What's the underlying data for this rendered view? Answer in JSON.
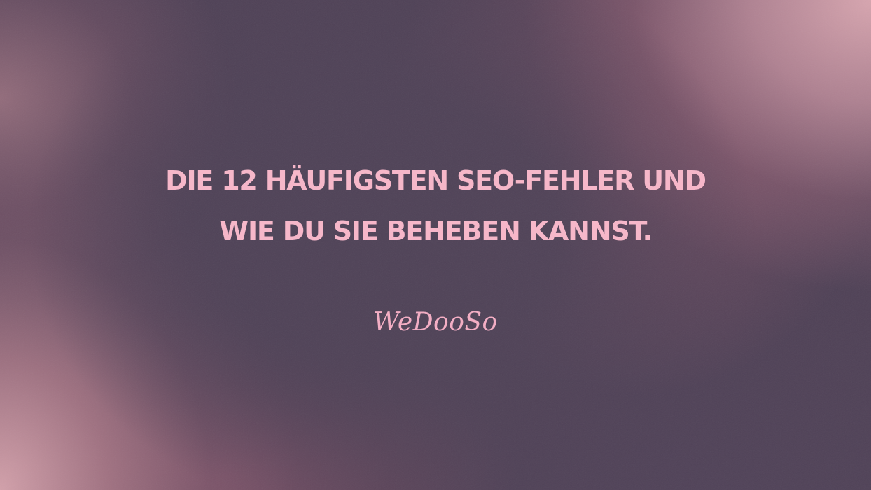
{
  "headline": {
    "line1": "DIE 12 HÄUFIGSTEN SEO-FEHLER UND",
    "line2": "WIE DU SIE BEHEBEN KANNST."
  },
  "brand": {
    "name": "WeDooSo"
  },
  "colors": {
    "background_dark": "#4f4156",
    "background_pink": "#d6a4b0",
    "accent_text": "#f6b7c9"
  }
}
